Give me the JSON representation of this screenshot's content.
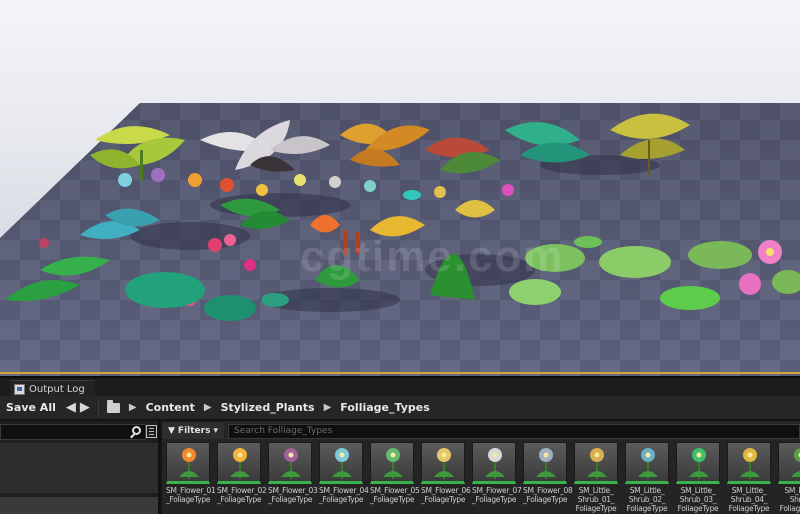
{
  "viewport": {
    "watermark": "cgtime.com"
  },
  "tabs": {
    "output_log": "Output Log"
  },
  "toolbar": {
    "save_all": "Save All",
    "breadcrumb": [
      "Content",
      "Stylized_Plants",
      "Folliage_Types"
    ]
  },
  "filters": {
    "label": "Filters",
    "search_placeholder": "Search Folliage_Types"
  },
  "assets": [
    {
      "name": "SM_Flower_01\n_FoliageType",
      "color": "#f08a2a"
    },
    {
      "name": "SM_Flower_02\n_FoliageType",
      "color": "#f2b43c"
    },
    {
      "name": "SM_Flower_03\n_FoliageType",
      "color": "#a0609a"
    },
    {
      "name": "SM_Flower_04\n_FoliageType",
      "color": "#7fc9d8"
    },
    {
      "name": "SM_Flower_05\n_FoliageType",
      "color": "#64b870"
    },
    {
      "name": "SM_Flower_06\n_FoliageType",
      "color": "#e6c86a"
    },
    {
      "name": "SM_Flower_07\n_FoliageType",
      "color": "#d8d8d8"
    },
    {
      "name": "SM_Flower_08\n_FoliageType",
      "color": "#9fb0c2"
    },
    {
      "name": "SM_Little_\nShrub_01_\nFoliageType",
      "color": "#d8b050"
    },
    {
      "name": "SM_Little_\nShrub_02_\nFoliageType",
      "color": "#6ab0c8"
    },
    {
      "name": "SM_Little_\nShrub_03_\nFoliageType",
      "color": "#3fc06a"
    },
    {
      "name": "SM_Little_\nShrub_04_\nFoliageType",
      "color": "#e0b840"
    },
    {
      "name": "SM_Little\nShrub\nFoliageType",
      "color": "#5aa048"
    }
  ]
}
